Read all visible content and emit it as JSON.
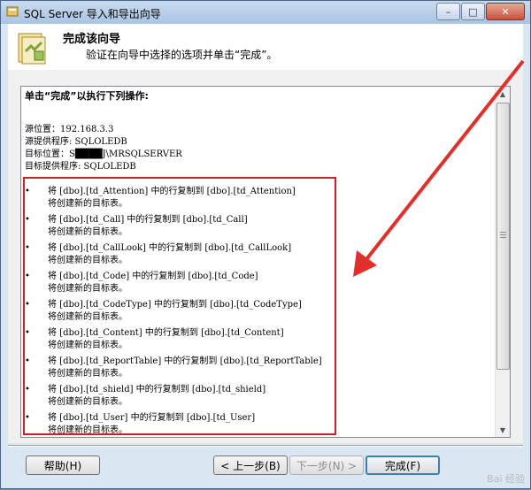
{
  "window": {
    "title": "SQL Server 导入和导出向导",
    "controls": {
      "minimize": "–",
      "maximize": "□",
      "close": "✕"
    }
  },
  "header": {
    "title": "完成该向导",
    "subtitle": "验证在向导中选择的选项并单击“完成”。"
  },
  "content": {
    "heading": "单击“完成”以执行下列操作:",
    "source_location": "源位置：192.168.3.3",
    "source_provider": "源提供程序: SQLOLEDB",
    "target_location": "目标位置：S████J\\MRSQLSERVER",
    "target_provider": "目标提供程序: SQLOLEDB",
    "bullet_char": "•",
    "items": [
      {
        "line": "将 [dbo].[td_Attention] 中的行复制到 [dbo].[td_Attention]",
        "sub": "将创建新的目标表。"
      },
      {
        "line": "将 [dbo].[td_Call] 中的行复制到 [dbo].[td_Call]",
        "sub": "将创建新的目标表。"
      },
      {
        "line": "将 [dbo].[td_CallLook] 中的行复制到 [dbo].[td_CallLook]",
        "sub": "将创建新的目标表。"
      },
      {
        "line": "将 [dbo].[td_Code] 中的行复制到 [dbo].[td_Code]",
        "sub": "将创建新的目标表。"
      },
      {
        "line": "将 [dbo].[td_CodeType] 中的行复制到 [dbo].[td_CodeType]",
        "sub": "将创建新的目标表。"
      },
      {
        "line": "将 [dbo].[td_Content] 中的行复制到 [dbo].[td_Content]",
        "sub": "将创建新的目标表。"
      },
      {
        "line": "将 [dbo].[td_ReportTable] 中的行复制到 [dbo].[td_ReportTable]",
        "sub": "将创建新的目标表。"
      },
      {
        "line": "将 [dbo].[td_shield] 中的行复制到 [dbo].[td_shield]",
        "sub": "将创建新的目标表。"
      },
      {
        "line": "将 [dbo].[td_User] 中的行复制到 [dbo].[td_User]",
        "sub": "将创建新的目标表。"
      }
    ]
  },
  "footer": {
    "help": "帮助(H)",
    "back": "< 上一步(B)",
    "next": "下一步(N) >",
    "finish": "完成(F)"
  },
  "watermark": "Bai 经验",
  "colors": {
    "highlight": "#c9232a",
    "arrow": "#e0302b"
  }
}
